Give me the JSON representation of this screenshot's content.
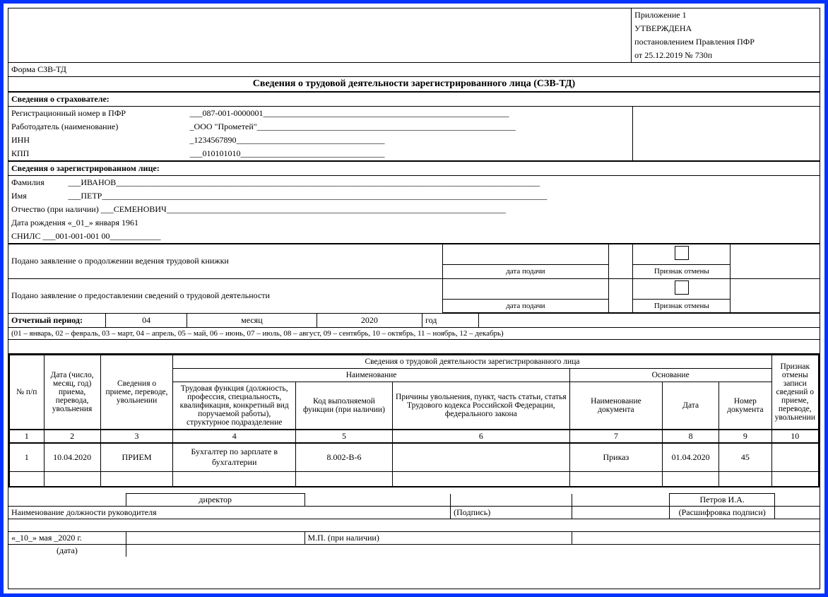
{
  "header": {
    "appendix": "Приложение 1",
    "approved": "УТВЕРЖДЕНА",
    "approved_by": "постановлением Правления ПФР",
    "approved_date": "от 25.12.2019   № 730п",
    "form_code": "Форма СЗВ-ТД",
    "title": "Сведения о трудовой деятельности зарегистрированного лица (СЗВ-ТД)"
  },
  "insurer": {
    "section_title": "Сведения о страхователе:",
    "reg_label": "Регистрационный номер в ПФР",
    "reg_value": "___087-001-0000001__________________________________________________________",
    "employer_label": "Работодатель (наименование)",
    "employer_value": "_ООО \"Прометей\"_____________________________________________________________",
    "inn_label": "ИНН",
    "inn_value": "_1234567890___________________________________",
    "kpp_label": "КПП",
    "kpp_value": "___010101010__________________________________"
  },
  "person": {
    "section_title": "Сведения о зарегистрированном лице:",
    "lastname_label": "Фамилия",
    "lastname_value": "___ИВАНОВ____________________________________________________________________________________________________",
    "firstname_label": "Имя",
    "firstname_value": "___ПЕТР_________________________________________________________________________________________________________",
    "patronymic_label": "Отчество (при наличии)",
    "patronymic_value": "___СЕМЕНОВИЧ________________________________________________________________________________",
    "birth_label": "Дата рождения «_01_» января  1961",
    "snils_label": "СНИЛС",
    "snils_value": "___001-001-001 00____________"
  },
  "applications": {
    "app1_label": "Подано заявление о продолжении ведения трудовой книжки",
    "app2_label": "Подано заявление о предоставлении сведений о трудовой деятельности",
    "date_hint": "дата подачи",
    "cancel_hint": "Признак отмены"
  },
  "period": {
    "label": "Отчетный период:",
    "month_value": "04",
    "month_label": "месяц",
    "year_value": "2020",
    "year_label": "год",
    "legend": "(01 – январь, 02 – февраль, 03 – март, 04 – апрель, 05 – май, 06 – июнь, 07 – июль, 08 – август, 09 – сентябрь, 10 – октябрь, 11 – ноябрь, 12 – декабрь)"
  },
  "table": {
    "header_main": "Сведения о трудовой деятельности зарегистрированного лица",
    "header_name": "Наименование",
    "header_basis": "Основание",
    "col1": "№ п/п",
    "col2": "Дата (число, месяц, год) приема, перевода, увольнения",
    "col3": "Сведения о приеме, переводе, увольнении",
    "col4": "Трудовая функция (должность, профессия, специальность, квалификация, конкретный вид поручаемой работы), структурное подразделение",
    "col5": "Код выполняемой функции (при наличии)",
    "col6": "Причины увольнения, пункт, часть статьи, статья Трудового кодекса Российской Федерации, федерального закона",
    "col7": "Наименование документа",
    "col8": "Дата",
    "col9": "Номер документа",
    "col10": "Признак отмены записи сведений о приеме, переводе, увольнении",
    "n1": "1",
    "n2": "2",
    "n3": "3",
    "n4": "4",
    "n5": "5",
    "n6": "6",
    "n7": "7",
    "n8": "8",
    "n9": "9",
    "n10": "10",
    "row": {
      "c1": "1",
      "c2": "10.04.2020",
      "c3": "ПРИЕМ",
      "c4": "Бухгалтер по зарплате в бухгалтерии",
      "c5": "8.002-В-6",
      "c6": "",
      "c7": "Приказ",
      "c8": "01.04.2020",
      "c9": "45",
      "c10": ""
    }
  },
  "signature": {
    "position_value": "директор",
    "position_label": "Наименование должности руководителя",
    "sign_label": "(Подпись)",
    "decipher_value": "Петров И.А.",
    "decipher_label": "(Расшифровка подписи)",
    "date_line": "«_10_»  мая  _2020 г.",
    "date_hint": "(дата)",
    "stamp_label": "М.П. (при наличии)"
  }
}
